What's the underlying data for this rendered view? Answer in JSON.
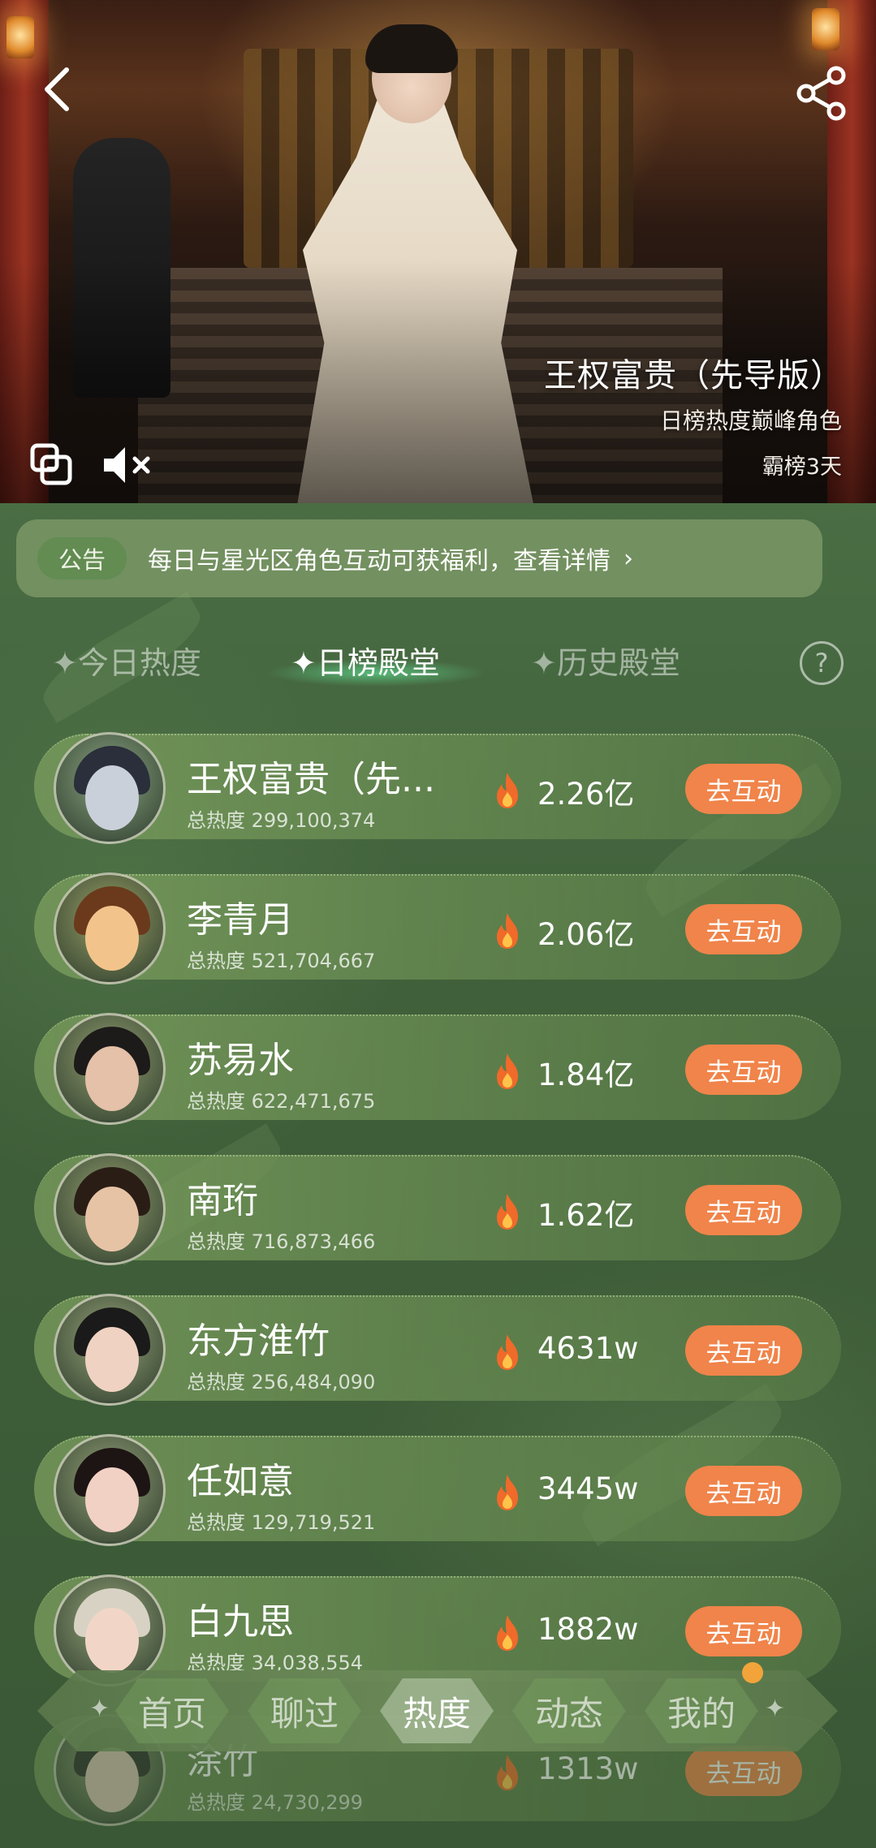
{
  "hero": {
    "title": "王权富贵（先导版）",
    "subtitle": "日榜热度巅峰角色",
    "days": "霸榜3天"
  },
  "notice": {
    "tag": "公告",
    "text": "每日与星光区角色互动可获福利，查看详情",
    "chevron": "›"
  },
  "tabs": [
    {
      "label": "✦今日热度",
      "active": false
    },
    {
      "label": "✦日榜殿堂",
      "active": true
    },
    {
      "label": "✦历史殿堂",
      "active": false
    }
  ],
  "help_label": "?",
  "ranking": [
    {
      "name": "王权富贵（先...",
      "total": "总热度 299,100,374",
      "heat": "2.26亿",
      "button": "去互动"
    },
    {
      "name": "李青月",
      "total": "总热度 521,704,667",
      "heat": "2.06亿",
      "button": "去互动"
    },
    {
      "name": "苏易水",
      "total": "总热度 622,471,675",
      "heat": "1.84亿",
      "button": "去互动"
    },
    {
      "name": "南珩",
      "total": "总热度 716,873,466",
      "heat": "1.62亿",
      "button": "去互动"
    },
    {
      "name": "东方淮竹",
      "total": "总热度 256,484,090",
      "heat": "4631w",
      "button": "去互动"
    },
    {
      "name": "任如意",
      "total": "总热度 129,719,521",
      "heat": "3445w",
      "button": "去互动"
    },
    {
      "name": "白九思",
      "total": "总热度 34,038,554",
      "heat": "1882w",
      "button": "去互动"
    },
    {
      "name": "涂竹",
      "total": "总热度 24,730,299",
      "heat": "1313w",
      "button": "去互动"
    }
  ],
  "nav": [
    {
      "label": "首页",
      "active": false
    },
    {
      "label": "聊过",
      "active": false
    },
    {
      "label": "热度",
      "active": true
    },
    {
      "label": "动态",
      "active": false
    },
    {
      "label": "我的",
      "active": false
    }
  ],
  "nav_spark": "✦",
  "colors": {
    "accent_button": "#f0844a",
    "green_bg": "#3f5e3b",
    "badge_dot": "#f2a43a"
  },
  "icons": {
    "back": "chevron-left-icon",
    "share": "share-icon",
    "pip": "picture-in-picture-icon",
    "mute": "volume-mute-icon",
    "fire": "fire-icon",
    "help": "question-circle-icon"
  }
}
